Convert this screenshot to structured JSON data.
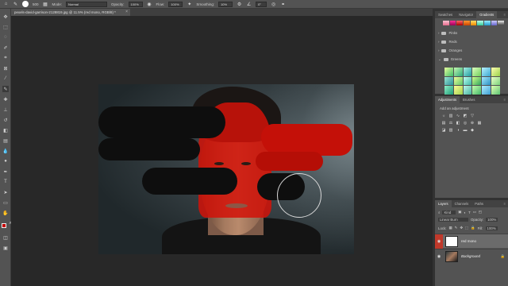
{
  "options_bar": {
    "mode_label": "Mode:",
    "mode_value": "Normal",
    "opacity_label": "Opacity:",
    "opacity_value": "100%",
    "flow_label": "Flow:",
    "flow_value": "100%",
    "smoothing_label": "Smoothing:",
    "smoothing_value": "10%",
    "angle_value": "0°",
    "brush_size": "500"
  },
  "document": {
    "tab_title": "pexels-david-garrison-2128819.jpg @ 11.5% (red mono, RGB/8) *",
    "close_glyph": "×"
  },
  "colors": {
    "foreground": "#c40000",
    "background": "#ffffff",
    "accent_layer_eye": "#c0392b"
  },
  "gradients_panel": {
    "tabs": [
      "Swatches",
      "Navigator",
      "Gradients"
    ],
    "active_tab": "Gradients",
    "folders": [
      "Pinks",
      "Reds",
      "Oranges",
      "Greens"
    ]
  },
  "adjustments_panel": {
    "tabs": [
      "Adjustments",
      "Brushes"
    ],
    "hint": "Add an adjustment"
  },
  "layers_panel": {
    "tabs": [
      "Layers",
      "Channels",
      "Paths"
    ],
    "kind_label": "Kind",
    "blend_mode": "Linear Burn",
    "opacity_label": "Opacity:",
    "opacity_value": "100%",
    "fill_label": "Fill:",
    "fill_value": "100%",
    "lock_label": "Lock:",
    "layers": [
      {
        "name": "red mono",
        "selected": true
      },
      {
        "name": "Background",
        "selected": false
      }
    ]
  },
  "icons": {
    "eye": "eye-icon",
    "brush": "brush-icon",
    "close": "close-icon"
  }
}
